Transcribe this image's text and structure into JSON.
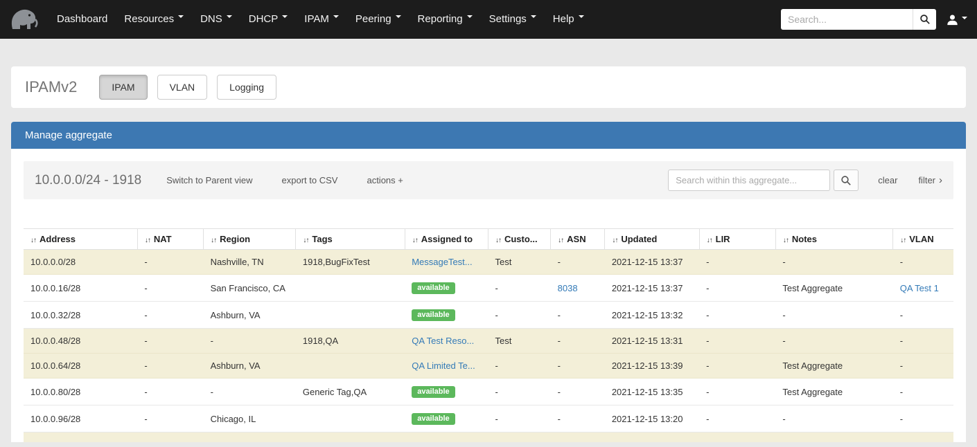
{
  "icons": {
    "sort_glyph": "↓↑",
    "filter_chevron": "›"
  },
  "colors": {
    "navbar_bg": "#1c1c1c",
    "accent_blue": "#3d78b2",
    "link": "#337ab7",
    "badge_green": "#5cb85c",
    "row_highlight": "#f3efd8"
  },
  "navbar": {
    "items": [
      {
        "label": "Dashboard",
        "caret": false
      },
      {
        "label": "Resources",
        "caret": true
      },
      {
        "label": "DNS",
        "caret": true
      },
      {
        "label": "DHCP",
        "caret": true
      },
      {
        "label": "IPAM",
        "caret": true
      },
      {
        "label": "Peering",
        "caret": true
      },
      {
        "label": "Reporting",
        "caret": true
      },
      {
        "label": "Settings",
        "caret": true
      },
      {
        "label": "Help",
        "caret": true
      }
    ],
    "search_placeholder": "Search..."
  },
  "page": {
    "title": "IPAMv2",
    "tabs": [
      {
        "label": "IPAM",
        "active": true
      },
      {
        "label": "VLAN",
        "active": false
      },
      {
        "label": "Logging",
        "active": false
      }
    ]
  },
  "panel": {
    "title": "Manage aggregate",
    "toolbar": {
      "aggregate_title": "10.0.0.0/24 - 1918",
      "links": [
        "Switch to Parent view",
        "export to CSV",
        "actions +"
      ],
      "search_placeholder": "Search within this aggregate...",
      "clear_label": "clear",
      "filter_label": "filter"
    },
    "table": {
      "columns": [
        "Address",
        "NAT",
        "Region",
        "Tags",
        "Assigned to",
        "Custo...",
        "ASN",
        "Updated",
        "LIR",
        "Notes",
        "VLAN"
      ],
      "rows": [
        {
          "highlight": true,
          "cells": [
            "10.0.0.0/28",
            "-",
            "Nashville, TN",
            "1918,BugFixTest",
            {
              "text": "MessageTest...",
              "kind": "link"
            },
            "Test",
            "-",
            "2021-12-15 13:37",
            "-",
            "-",
            "-"
          ]
        },
        {
          "highlight": false,
          "cells": [
            "10.0.0.16/28",
            "-",
            "San Francisco, CA",
            "",
            {
              "text": "available",
              "kind": "badge"
            },
            "-",
            {
              "text": "8038",
              "kind": "link"
            },
            "2021-12-15 13:37",
            "-",
            "Test Aggregate",
            {
              "text": "QA Test 1",
              "kind": "link"
            }
          ]
        },
        {
          "highlight": false,
          "cells": [
            "10.0.0.32/28",
            "-",
            "Ashburn, VA",
            "",
            {
              "text": "available",
              "kind": "badge"
            },
            "-",
            "-",
            "2021-12-15 13:32",
            "-",
            "-",
            "-"
          ]
        },
        {
          "highlight": true,
          "cells": [
            "10.0.0.48/28",
            "-",
            "-",
            "1918,QA",
            {
              "text": "QA Test Reso...",
              "kind": "link"
            },
            "Test",
            "-",
            "2021-12-15 13:31",
            "-",
            "-",
            "-"
          ]
        },
        {
          "highlight": true,
          "cells": [
            "10.0.0.64/28",
            "-",
            "Ashburn, VA",
            "",
            {
              "text": "QA Limited Te...",
              "kind": "link"
            },
            "-",
            "-",
            "2021-12-15 13:39",
            "-",
            "Test Aggregate",
            "-"
          ]
        },
        {
          "highlight": false,
          "cells": [
            "10.0.0.80/28",
            "-",
            "-",
            "Generic Tag,QA",
            {
              "text": "available",
              "kind": "badge"
            },
            "-",
            "-",
            "2021-12-15 13:35",
            "-",
            "Test Aggregate",
            "-"
          ]
        },
        {
          "highlight": false,
          "cells": [
            "10.0.0.96/28",
            "-",
            "Chicago, IL",
            "",
            {
              "text": "available",
              "kind": "badge"
            },
            "-",
            "-",
            "2021-12-15 13:20",
            "-",
            "-",
            "-"
          ]
        }
      ]
    }
  }
}
